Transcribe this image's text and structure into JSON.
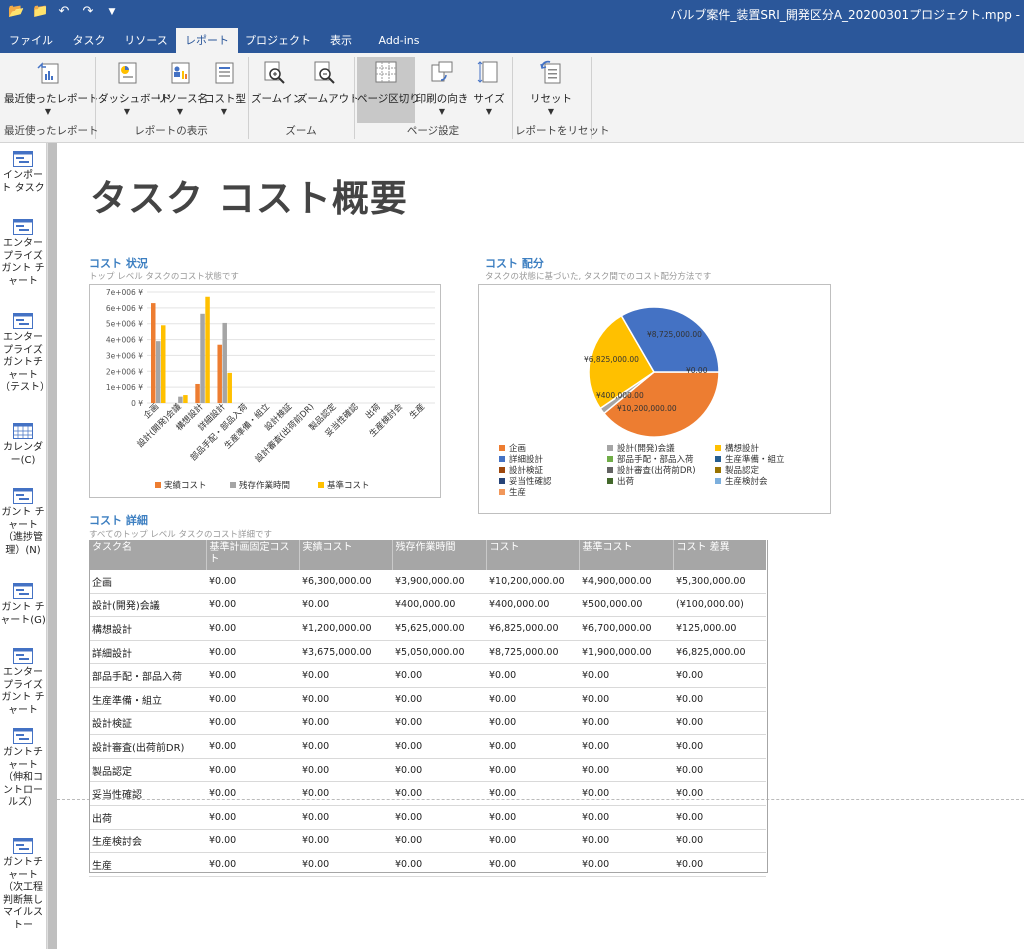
{
  "window": {
    "title": "バルブ案件_装置SRI_開発区分A_20200301プロジェクト.mpp -"
  },
  "qat": {
    "open_icon": "folder-open-icon",
    "save_icon": "folder-icon",
    "undo_icon": "undo-icon",
    "redo_icon": "redo-icon",
    "customize_icon": "qat-dropdown-icon"
  },
  "tabs": [
    {
      "label": "ファイル"
    },
    {
      "label": "タスク"
    },
    {
      "label": "リソース"
    },
    {
      "label": "レポート"
    },
    {
      "label": "プロジェクト"
    },
    {
      "label": "表示"
    },
    {
      "label": "Add-ins"
    }
  ],
  "ribbon": {
    "recent_reports": "最近使ったレポート",
    "dashboard": "ダッシュボード",
    "resources": "リソース名",
    "cost": "コスト型",
    "zoom_in": "ズームイン",
    "zoom_out": "ズームアウト",
    "page_breaks": "ページ区切り",
    "orientation": "印刷の向き",
    "size": "サイズ",
    "reset": "リセット",
    "groups": {
      "recent": "最近使ったレポート",
      "view": "レポートの表示",
      "zoom": "ズーム",
      "page_setup": "ページ設定",
      "reset": "レポートをリセット"
    }
  },
  "views": [
    {
      "label": "インポート タスク"
    },
    {
      "label": "エンタープライズ ガント チャート"
    },
    {
      "label": "エンタープライズ ガントチャート（テスト）"
    },
    {
      "label": "カレンダー(C)"
    },
    {
      "label": "ガント チャート（進捗管理）(N)"
    },
    {
      "label": "ガント チャート(G)"
    },
    {
      "label": "エンタープライズ ガント チャート"
    },
    {
      "label": "ガントチャート（伸和コントロールズ）"
    },
    {
      "label": "ガントチャート（次工程判断無しマイルストー"
    }
  ],
  "report": {
    "title": "タスク コスト概要",
    "cost_status": {
      "title": "コスト 状況",
      "subtitle": "トップ レベル タスクのコスト状態です"
    },
    "cost_distribution": {
      "title": "コスト 配分",
      "subtitle": "タスクの状態に基づいた, タスク間でのコスト配分方法です"
    },
    "cost_details": {
      "title": "コスト 詳細",
      "subtitle": "すべてのトップ レベル タスクのコスト詳細です"
    }
  },
  "chart_data": [
    {
      "type": "bar",
      "title": "",
      "categories": [
        "企画",
        "設計(開発)会議",
        "構想設計",
        "詳細設計",
        "部品手配・部品入荷",
        "生産準備・組立",
        "設計検証",
        "設計審査(出荷前DR)",
        "製品認定",
        "妥当性確認",
        "出荷",
        "生産検討会",
        "生産"
      ],
      "series": [
        {
          "name": "実績コスト",
          "color": "#ed7d31",
          "values": [
            6300000,
            0,
            1200000,
            3675000,
            0,
            0,
            0,
            0,
            0,
            0,
            0,
            0,
            0
          ]
        },
        {
          "name": "残存作業時間",
          "color": "#a5a5a5",
          "values": [
            3900000,
            400000,
            5625000,
            5050000,
            0,
            0,
            0,
            0,
            0,
            0,
            0,
            0,
            0
          ]
        },
        {
          "name": "基準コスト",
          "color": "#ffc000",
          "values": [
            4900000,
            500000,
            6700000,
            1900000,
            0,
            0,
            0,
            0,
            0,
            0,
            0,
            0,
            0
          ]
        }
      ],
      "ylim": [
        0,
        7000000
      ],
      "yticks": [
        "0 ¥",
        "1e+006 ¥",
        "2e+006 ¥",
        "3e+006 ¥",
        "4e+006 ¥",
        "5e+006 ¥",
        "6e+006 ¥",
        "7e+006 ¥"
      ],
      "legend": "bottom"
    },
    {
      "type": "pie",
      "title": "",
      "slices": [
        {
          "name": "企画",
          "value": 10200000,
          "label": "¥10,200,000.00",
          "color": "#ed7d31"
        },
        {
          "name": "設計(開発)会議",
          "value": 400000,
          "label": "¥400,000.00",
          "color": "#a5a5a5"
        },
        {
          "name": "構想設計",
          "value": 6825000,
          "label": "¥6,825,000.00",
          "color": "#ffc000"
        },
        {
          "name": "詳細設計",
          "value": 8725000,
          "label": "¥8,725,000.00",
          "color": "#4472c4"
        },
        {
          "name": "部品手配・部品入荷",
          "value": 0,
          "label": "¥0.00",
          "color": "#70ad47"
        },
        {
          "name": "生産準備・組立",
          "value": 0,
          "label": "",
          "color": "#255e91"
        },
        {
          "name": "設計検証",
          "value": 0,
          "label": "",
          "color": "#9e480e"
        },
        {
          "name": "設計審査(出荷前DR)",
          "value": 0,
          "label": "",
          "color": "#636363"
        },
        {
          "name": "製品認定",
          "value": 0,
          "label": "",
          "color": "#997300"
        },
        {
          "name": "妥当性確認",
          "value": 0,
          "label": "",
          "color": "#264478"
        },
        {
          "name": "出荷",
          "value": 0,
          "label": "",
          "color": "#43682b"
        },
        {
          "name": "生産検討会",
          "value": 0,
          "label": "",
          "color": "#7cafdd"
        },
        {
          "name": "生産",
          "value": 0,
          "label": "",
          "color": "#f1975a"
        }
      ],
      "legend": "bottom"
    }
  ],
  "table": {
    "columns": [
      "タスク名",
      "基準計画固定コスト",
      "実績コスト",
      "残存作業時間",
      "コスト",
      "基準コスト",
      "コスト 差異"
    ],
    "rows": [
      [
        "企画",
        "¥0.00",
        "¥6,300,000.00",
        "¥3,900,000.00",
        "¥10,200,000.00",
        "¥4,900,000.00",
        "¥5,300,000.00"
      ],
      [
        "設計(開発)会議",
        "¥0.00",
        "¥0.00",
        "¥400,000.00",
        "¥400,000.00",
        "¥500,000.00",
        "(¥100,000.00)"
      ],
      [
        "構想設計",
        "¥0.00",
        "¥1,200,000.00",
        "¥5,625,000.00",
        "¥6,825,000.00",
        "¥6,700,000.00",
        "¥125,000.00"
      ],
      [
        "詳細設計",
        "¥0.00",
        "¥3,675,000.00",
        "¥5,050,000.00",
        "¥8,725,000.00",
        "¥1,900,000.00",
        "¥6,825,000.00"
      ],
      [
        "部品手配・部品入荷",
        "¥0.00",
        "¥0.00",
        "¥0.00",
        "¥0.00",
        "¥0.00",
        "¥0.00"
      ],
      [
        "生産準備・組立",
        "¥0.00",
        "¥0.00",
        "¥0.00",
        "¥0.00",
        "¥0.00",
        "¥0.00"
      ],
      [
        "設計検証",
        "¥0.00",
        "¥0.00",
        "¥0.00",
        "¥0.00",
        "¥0.00",
        "¥0.00"
      ],
      [
        "設計審査(出荷前DR)",
        "¥0.00",
        "¥0.00",
        "¥0.00",
        "¥0.00",
        "¥0.00",
        "¥0.00"
      ],
      [
        "製品認定",
        "¥0.00",
        "¥0.00",
        "¥0.00",
        "¥0.00",
        "¥0.00",
        "¥0.00"
      ],
      [
        "妥当性確認",
        "¥0.00",
        "¥0.00",
        "¥0.00",
        "¥0.00",
        "¥0.00",
        "¥0.00"
      ],
      [
        "出荷",
        "¥0.00",
        "¥0.00",
        "¥0.00",
        "¥0.00",
        "¥0.00",
        "¥0.00"
      ],
      [
        "生産検討会",
        "¥0.00",
        "¥0.00",
        "¥0.00",
        "¥0.00",
        "¥0.00",
        "¥0.00"
      ],
      [
        "生産",
        "¥0.00",
        "¥0.00",
        "¥0.00",
        "¥0.00",
        "¥0.00",
        "¥0.00"
      ]
    ]
  }
}
